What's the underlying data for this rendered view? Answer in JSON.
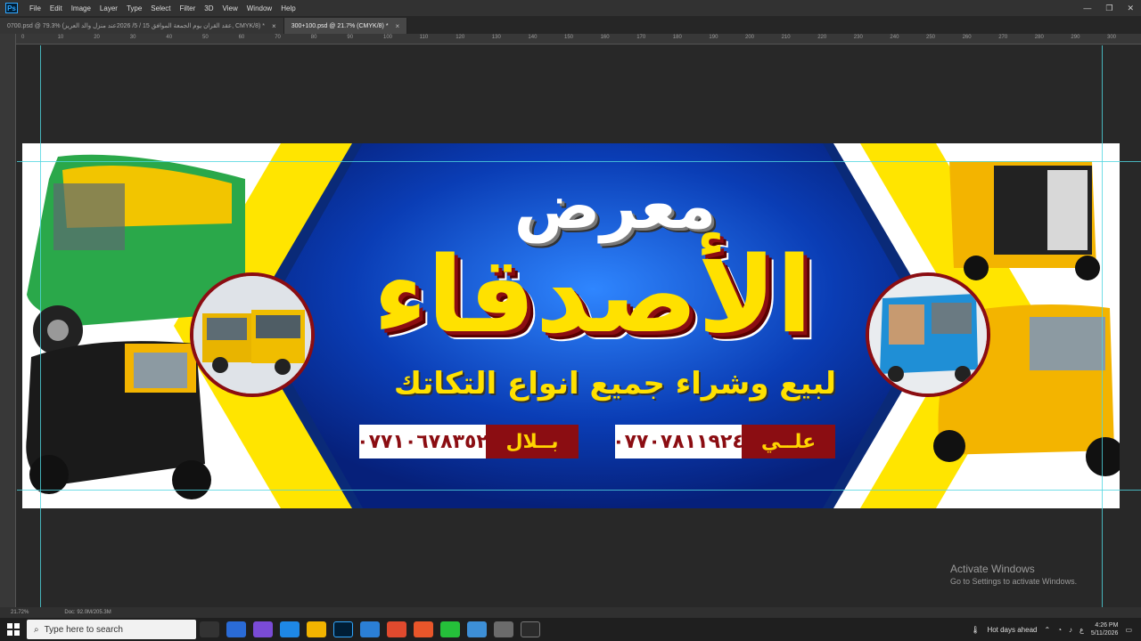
{
  "app": {
    "name": "Photoshop",
    "logo": "Ps"
  },
  "menu": [
    "File",
    "Edit",
    "Image",
    "Layer",
    "Type",
    "Select",
    "Filter",
    "3D",
    "View",
    "Window",
    "Help"
  ],
  "window_controls": [
    "—",
    "❐",
    "✕"
  ],
  "tabs": [
    {
      "label": "0700.psd @ 79.3% (عقد القران يوم  الجمعة الموافق 15 / 5/ 2026عند منزل والد العريز, CMYK/8) *",
      "active": false
    },
    {
      "label": "300+100.psd @ 21.7% (CMYK/8) *",
      "active": true
    }
  ],
  "ruler_top_labels": [
    "0",
    "10",
    "20",
    "30",
    "40",
    "50",
    "60",
    "70",
    "80",
    "90",
    "100",
    "110",
    "120",
    "130",
    "140",
    "150",
    "160",
    "170",
    "180",
    "190",
    "200",
    "210",
    "220",
    "230",
    "240",
    "250",
    "260",
    "270",
    "280",
    "290",
    "300"
  ],
  "banner": {
    "title_line1": "معرض",
    "title_line2": "الأصدقاء",
    "subtitle": "لبيع وشراء جميع انواع التكاتك",
    "contact1": {
      "name": "بــلال",
      "phone": "٠٧٧١٠٦٧٨٣٥٢"
    },
    "contact2": {
      "name": "علــي",
      "phone": "٠٧٧٠٧٨١١٩٢٤"
    },
    "colors": {
      "blue": "#0a3db5",
      "yellow": "#ffe500",
      "red": "#8b0d12"
    }
  },
  "status": {
    "zoom": "21.72%",
    "doc": "Doc: 92.0M/205.3M"
  },
  "watermark": {
    "title": "Activate Windows",
    "subtitle": "Go to Settings to activate Windows."
  },
  "taskbar": {
    "search_placeholder": "Type here to search",
    "weather": "Hot days ahead",
    "time": "4:26 PM",
    "date": "5/11/2026",
    "lang": "ع"
  }
}
